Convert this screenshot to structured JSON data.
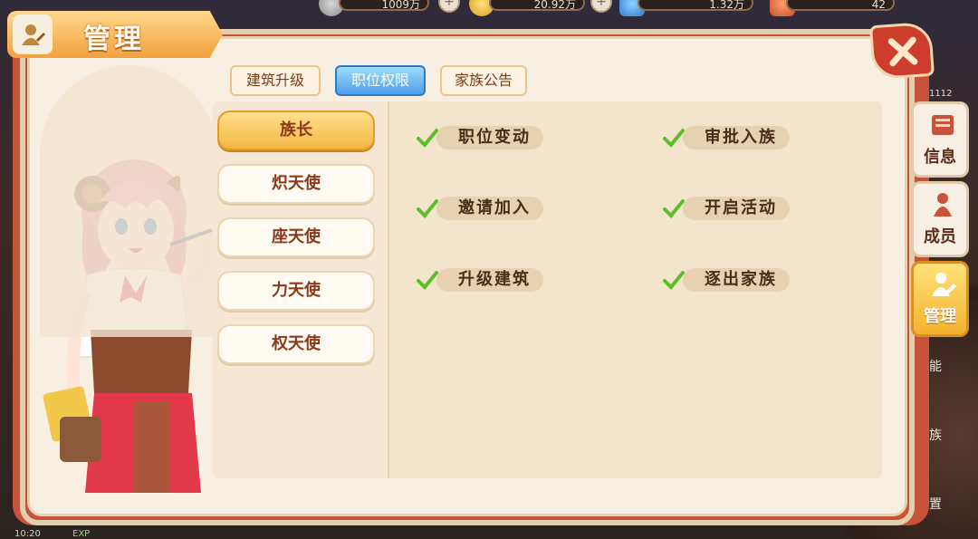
{
  "hud": {
    "resource_1": "1009万",
    "resource_2": "20.92万",
    "resource_3": "1.32万",
    "resource_4": "42",
    "level_number": "1112"
  },
  "status": {
    "time": "10:20",
    "exp_label": "EXP"
  },
  "title": "管理",
  "top_tabs": [
    {
      "label": "建筑升级",
      "active": false
    },
    {
      "label": "职位权限",
      "active": true
    },
    {
      "label": "家族公告",
      "active": false
    }
  ],
  "roles": [
    {
      "label": "族长",
      "active": true
    },
    {
      "label": "炽天使",
      "active": false
    },
    {
      "label": "座天使",
      "active": false
    },
    {
      "label": "力天使",
      "active": false
    },
    {
      "label": "权天使",
      "active": false
    }
  ],
  "permissions": [
    {
      "label": "职位变动",
      "checked": true
    },
    {
      "label": "审批入族",
      "checked": true
    },
    {
      "label": "邀请加入",
      "checked": true
    },
    {
      "label": "开启活动",
      "checked": true
    },
    {
      "label": "升级建筑",
      "checked": true
    },
    {
      "label": "逐出家族",
      "checked": true
    }
  ],
  "side_tabs": [
    {
      "label": "信息",
      "icon": "book-icon",
      "active": false
    },
    {
      "label": "成员",
      "icon": "person-icon",
      "active": false
    },
    {
      "label": "管理",
      "icon": "manage-user-icon",
      "active": true
    }
  ],
  "side_peek": [
    "能",
    "族",
    "置"
  ],
  "colors": {
    "accent_gold": "#f2b742",
    "active_tab_blue": "#4a9ee8",
    "panel_red": "#c9533a",
    "check_green": "#5bbf2a"
  }
}
